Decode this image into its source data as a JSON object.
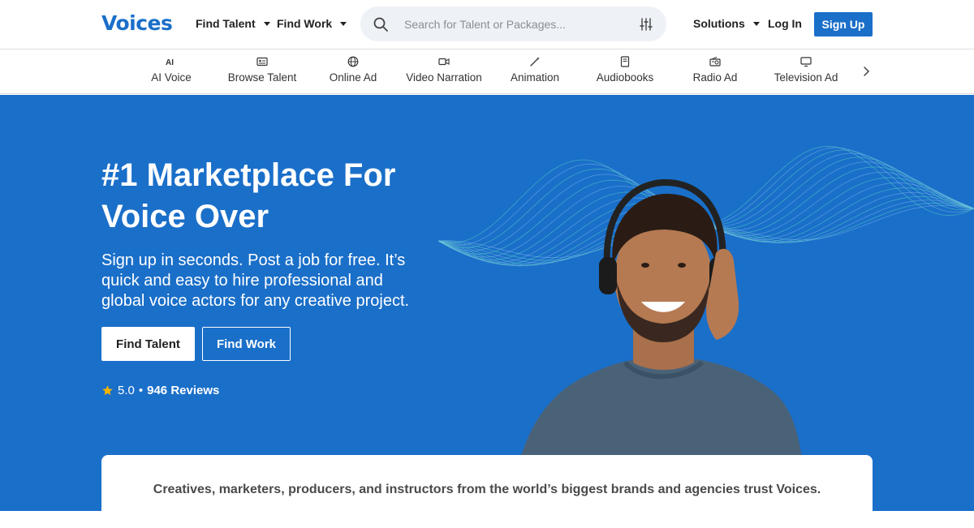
{
  "brand": {
    "logo": "Voices",
    "accent": "#1a6fc9"
  },
  "nav": {
    "find_talent": "Find Talent",
    "find_work": "Find Work",
    "search_placeholder": "Search for Talent or Packages...",
    "solutions": "Solutions",
    "login": "Log In",
    "signup": "Sign Up"
  },
  "categories": [
    {
      "label": "AI Voice",
      "icon": "ai-icon"
    },
    {
      "label": "Browse Talent",
      "icon": "id-card-icon"
    },
    {
      "label": "Online Ad",
      "icon": "globe-icon"
    },
    {
      "label": "Video Narration",
      "icon": "video-camera-icon"
    },
    {
      "label": "Animation",
      "icon": "magic-wand-icon"
    },
    {
      "label": "Audiobooks",
      "icon": "book-icon"
    },
    {
      "label": "Radio Ad",
      "icon": "radio-icon"
    },
    {
      "label": "Television Ad",
      "icon": "tv-icon"
    }
  ],
  "hero": {
    "title": "#1 Marketplace For Voice Over",
    "subtitle": "Sign up in seconds. Post a job for free. It’s quick and easy to hire professional and global voice actors for any creative project.",
    "cta_primary": "Find Talent",
    "cta_secondary": "Find Work",
    "rating_score": "5.0",
    "rating_sep": "•",
    "rating_reviews": "946 Reviews"
  },
  "trust": {
    "text": "Creatives, marketers, producers, and instructors from the world’s biggest brands and agencies trust Voices."
  }
}
